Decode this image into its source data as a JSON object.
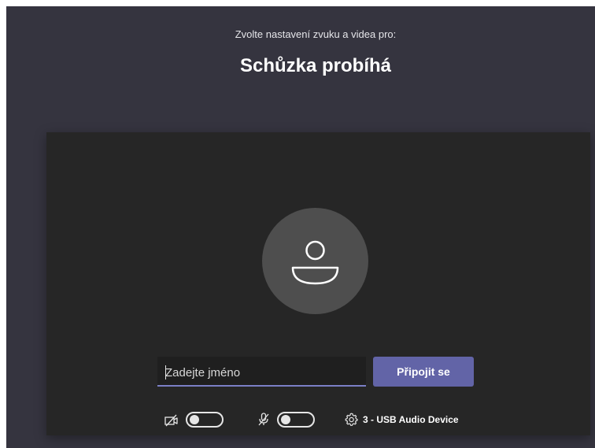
{
  "header": {
    "subtitle": "Zvolte nastavení zvuku a videa pro:",
    "title": "Schůzka probíhá"
  },
  "preview": {
    "avatar_icon": "person-icon"
  },
  "join": {
    "name_placeholder": "Zadejte jméno",
    "name_value": "",
    "join_label": "Připojit se"
  },
  "controls": {
    "camera": {
      "icon": "camera-off-icon",
      "on": false
    },
    "microphone": {
      "icon": "mic-off-icon",
      "on": false
    },
    "audio_device": {
      "icon": "gear-icon",
      "label": "3 - USB Audio Device"
    }
  },
  "colors": {
    "background": "#35343f",
    "preview": "#262626",
    "avatar": "#4e4e4e",
    "accent": "#6264a7",
    "input_underline": "#7b7fc6"
  }
}
